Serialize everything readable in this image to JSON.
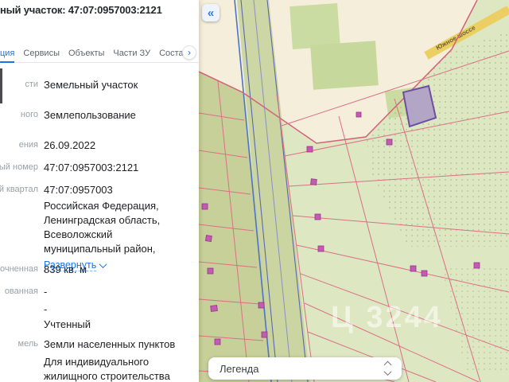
{
  "panel": {
    "title": "ный участок: 47:07:0957003:2121",
    "tabs": [
      {
        "label": "ция",
        "active": true
      },
      {
        "label": "Сервисы",
        "active": false
      },
      {
        "label": "Объекты",
        "active": false
      },
      {
        "label": "Части ЗУ",
        "active": false
      },
      {
        "label": "Состав",
        "active": false
      }
    ],
    "address_expand": "Развернуть",
    "fields": [
      {
        "label": "сти",
        "value": "Земельный участок"
      },
      {
        "label": "ного",
        "value": "Землепользование"
      },
      {
        "label": "ения",
        "value": "26.09.2022"
      },
      {
        "label": "ный номер",
        "value": "47:07:0957003:2121"
      },
      {
        "label": "ый квартал",
        "value": "47:07:0957003"
      },
      {
        "label": "",
        "value": "Российская Федерация,\nЛенинградская область,\nВсеволожский муниципальный район,"
      },
      {
        "label": "очненная",
        "value": "839 кв. м"
      },
      {
        "label": "ованная",
        "value": "-"
      },
      {
        "label": "",
        "value": "-"
      },
      {
        "label": "",
        "value": "Учтенный"
      },
      {
        "label": "мель",
        "value": "Земли населенных пунктов"
      },
      {
        "label": "",
        "value": "Для индивидуального жилищного строительства"
      }
    ]
  },
  "map": {
    "collapse_button": "«",
    "road_label": "Южное шоссе",
    "legend_label": "Легенда",
    "watermark": "Ц 3244"
  },
  "icons": {
    "chevron_right": "›"
  },
  "colors": {
    "accent_blue": "#1a73e8",
    "parcel_line_pink": "#dc6f87",
    "selected_parcel_fill": "#b2a5c6",
    "selected_parcel_border": "#6f4da2",
    "building_fill": "#c35cb0",
    "map_green": "#dde7c1",
    "map_beige": "#f4eeda",
    "road_yellow": "#eccf63"
  }
}
